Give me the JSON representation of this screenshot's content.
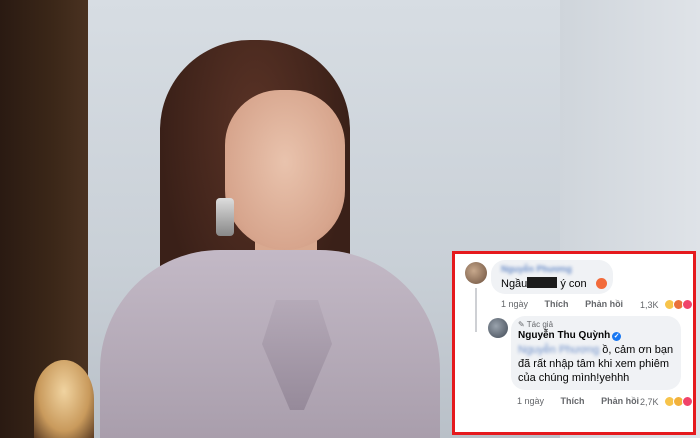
{
  "comment": {
    "author": "Nguyễn Phương",
    "text_before": "Ngầu",
    "text_after": " ý con",
    "time": "1 ngày",
    "like_label": "Thích",
    "reply_label": "Phản hồi",
    "reaction_count": "1,3K"
  },
  "reply": {
    "author_tag": "Tác giả",
    "author": "Nguyễn Thu Quỳnh",
    "mention": "Nguyễn Phương",
    "text": " ồ, cảm ơn bạn đã rất nhập tâm khi xem phiêm của chúng mình!yehhh",
    "time": "1 ngày",
    "like_label": "Thích",
    "reply_label": "Phản hồi",
    "reaction_count": "2,7K"
  },
  "colors": {
    "frame": "#e5191d",
    "bubble": "#f0f2f5",
    "verified": "#1877f2"
  }
}
